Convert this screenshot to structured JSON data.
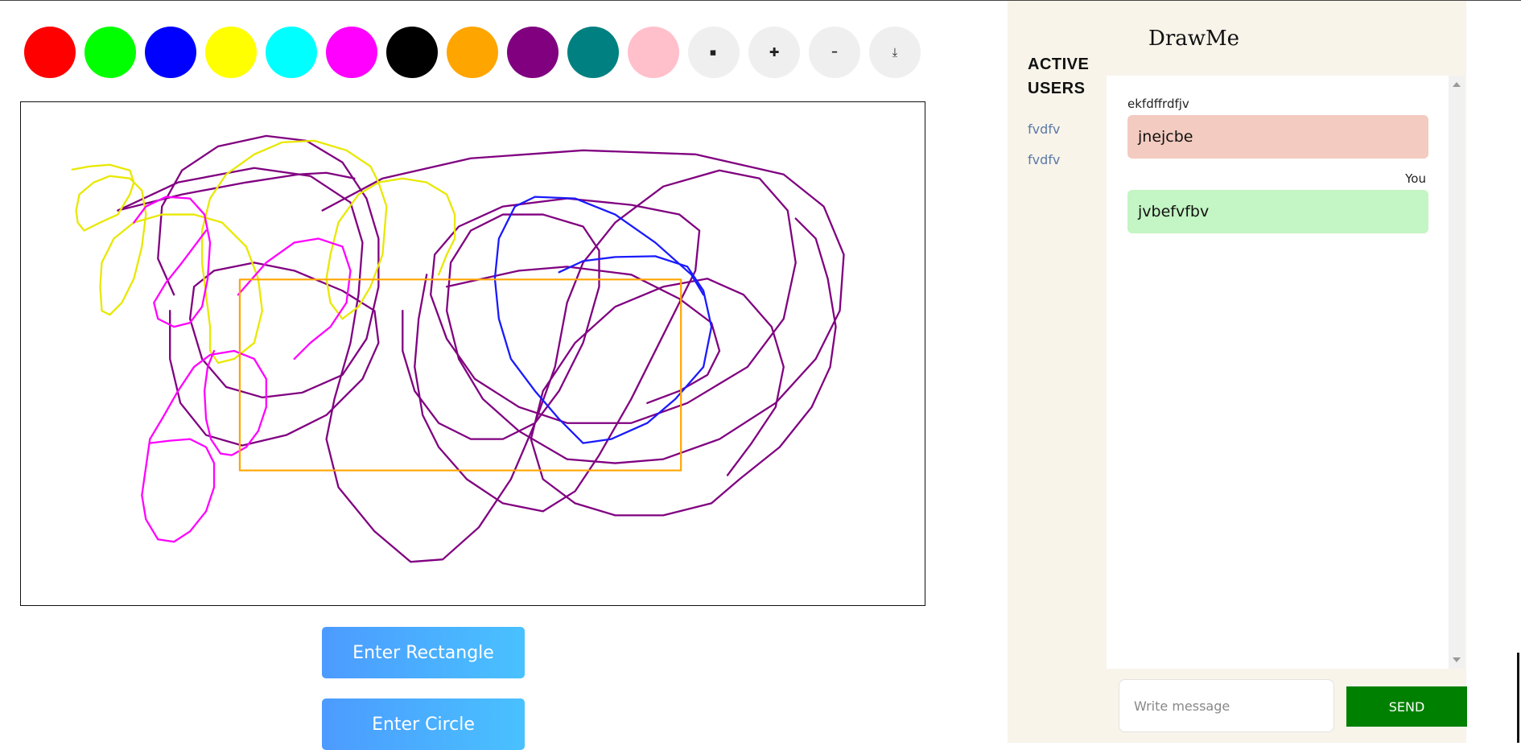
{
  "toolbar": {
    "colors": [
      "#ff0000",
      "#00ff00",
      "#0000ff",
      "#ffff00",
      "#00ffff",
      "#ff00ff",
      "#000000",
      "#ffa500",
      "#800080",
      "#008080",
      "#ffc0cb"
    ],
    "tools": [
      "eraser-icon",
      "zoom-in-icon",
      "zoom-out-icon",
      "download-icon"
    ],
    "tool_glyphs": [
      "◆",
      "✚",
      "━",
      "⤓"
    ]
  },
  "actions": {
    "rectangle_label": "Enter Rectangle",
    "circle_label": "Enter Circle"
  },
  "users": {
    "title": "ACTIVE USERS",
    "list": [
      "fvdfv",
      "fvdfv"
    ]
  },
  "chat": {
    "title": "DrawMe",
    "messages": [
      {
        "sender": "ekfdffrdfjv",
        "text": "jnejcbe",
        "color": "#f3cbc0",
        "own": false
      },
      {
        "sender": "You",
        "text": "jvbefvfbv",
        "color": "#c4f5c4",
        "own": true
      }
    ],
    "input_placeholder": "Write message",
    "send_label": "SEND"
  },
  "colors": {
    "panel_bg": "#f8f4ea",
    "send_button": "#008000",
    "shape_rectangle": "#ffa500",
    "user_link": "#5b79a8"
  }
}
